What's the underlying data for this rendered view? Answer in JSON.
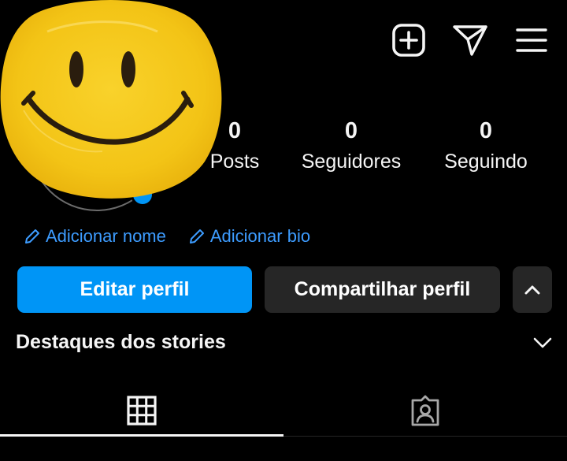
{
  "header": {
    "icons": [
      "add-post-icon",
      "direct-message-icon",
      "menu-icon"
    ]
  },
  "stats": [
    {
      "count": "0",
      "label": "Posts"
    },
    {
      "count": "0",
      "label": "Seguidores"
    },
    {
      "count": "0",
      "label": "Seguindo"
    }
  ],
  "bio": {
    "add_name": "Adicionar nome",
    "add_bio": "Adicionar bio"
  },
  "actions": {
    "edit_profile": "Editar perfil",
    "share_profile": "Compartilhar perfil"
  },
  "highlights": {
    "title": "Destaques dos stories"
  },
  "colors": {
    "accent": "#0095f6",
    "link": "#3d9cff",
    "button_secondary": "#262626",
    "background": "#000000",
    "avatar_yellow": "#f4c418"
  }
}
